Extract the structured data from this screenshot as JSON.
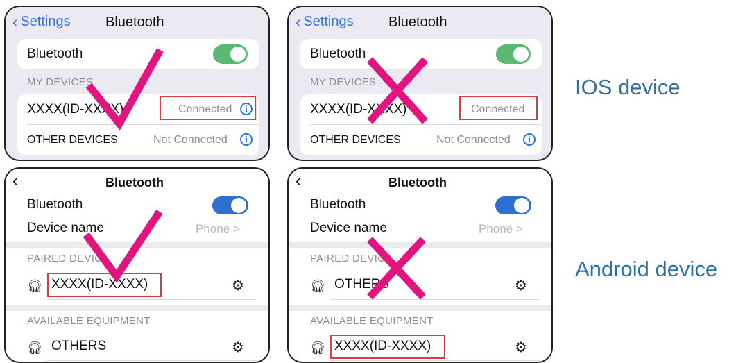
{
  "ios": {
    "back_label": "Settings",
    "title": "Bluetooth",
    "bluetooth_label": "Bluetooth",
    "my_devices_label": "MY DEVICES",
    "device_name": "XXXX(ID-XXXX)",
    "connected_label": "Connected",
    "other_devices_label": "OTHER DEVICES",
    "not_connected_label": "Not Connected",
    "toggle_color": "#5bb974"
  },
  "android": {
    "title": "Bluetooth",
    "bluetooth_label": "Bluetooth",
    "device_name_label": "Device name",
    "device_name_value": "Phone >",
    "paired_label": "PAIRED DEVICE",
    "available_label": "AVAILABLE EQUIPMENT",
    "device_name": "XXXX(ID-XXXX)",
    "others_label": "OTHERS",
    "toggle_color": "#2f6fd0"
  },
  "captions": {
    "ios": "IOS device",
    "android": "Android device"
  },
  "colors": {
    "mark": "#e0157f",
    "highlight": "#e23a3a",
    "ios_blue": "#2f74e0",
    "caption": "#2d6fa8"
  }
}
